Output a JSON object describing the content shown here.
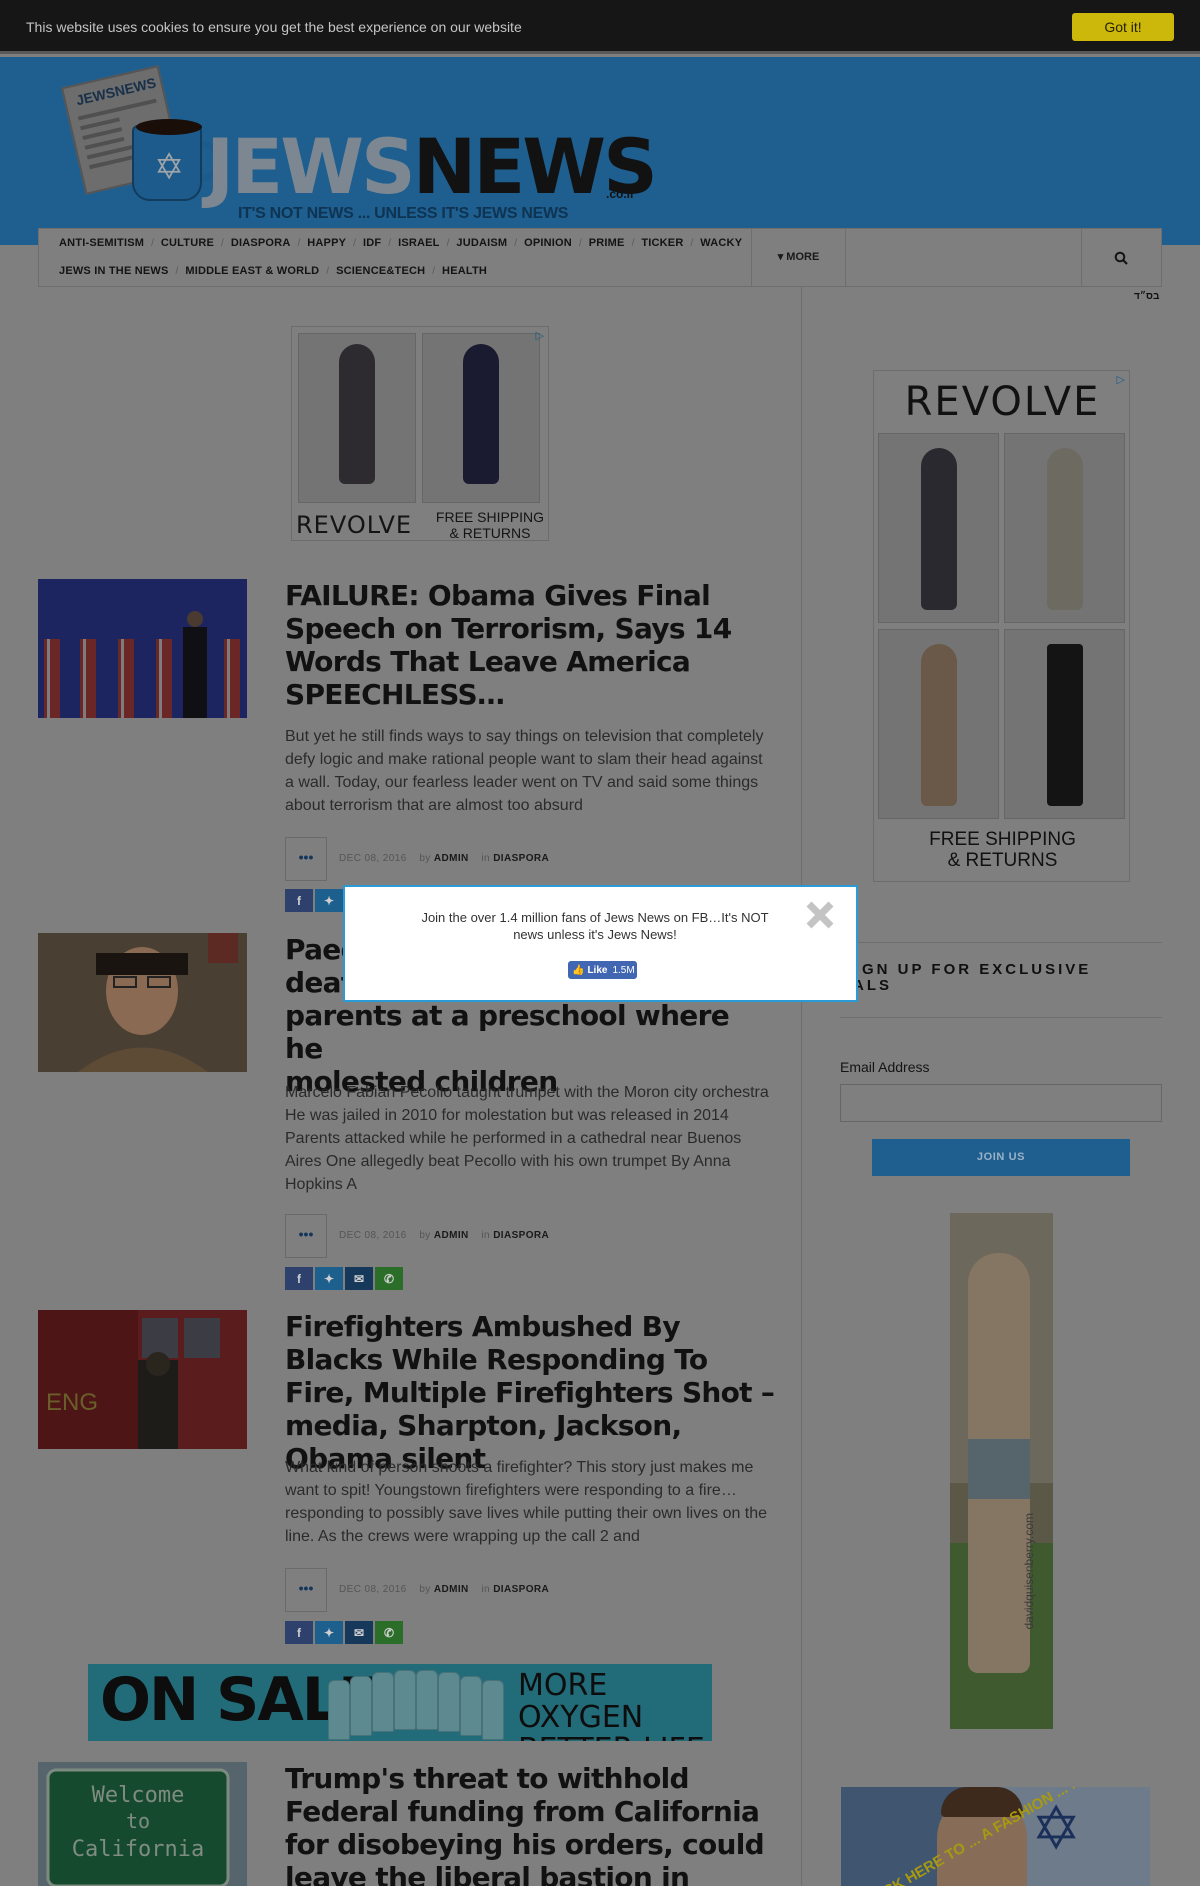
{
  "cookie": {
    "message": "This website uses cookies to ensure you get the best experience on our website",
    "button": "Got it!"
  },
  "header": {
    "logo_paper": "JEWSNEWS",
    "logo_word_1": "JEWS",
    "logo_word_2": "NEWS",
    "logo_tld": ".co.il",
    "tagline": "IT'S NOT NEWS ... UNLESS IT'S JEWS NEWS"
  },
  "nav": {
    "row1": [
      "ANTI-SEMITISM",
      "CULTURE",
      "DIASPORA",
      "HAPPY",
      "IDF",
      "ISRAEL",
      "JUDAISM",
      "OPINION",
      "PRIME",
      "TICKER",
      "WACKY"
    ],
    "row2": [
      "JEWS IN THE NEWS",
      "MIDDLE EAST & WORLD",
      "SCIENCE&TECH",
      "HEALTH"
    ],
    "more": "▾ MORE",
    "bsd": "בס״ד"
  },
  "ads": {
    "top": {
      "brand": "REVOLVE",
      "shipping": "FREE SHIPPING & RETURNS"
    },
    "side": {
      "brand": "REVOLVE",
      "shipping_1": "FREE SHIPPING",
      "shipping_2": "& RETURNS"
    },
    "adchoices_icon": "adchoices-icon",
    "sale": {
      "on_sale": "ON SALE",
      "line1": "MORE OXYGEN",
      "line2": "BETTER LIFE"
    },
    "tall": {
      "credit": "davidquisenberry.com"
    },
    "bottom": {
      "cta": "CLICK HERE TO ... A FASHION ... MENT"
    }
  },
  "articles": [
    {
      "title": "FAILURE: Obama Gives Final Speech on Terrorism, Says 14 Words That Leave America SPEECHLESS…",
      "excerpt": "But yet he still finds ways to say things on television that completely defy logic and make rational people want to slam their head against a wall. Today, our fearless leader went on TV and said some things about terrorism that are almost too absurd",
      "date": "DEC 08, 2016",
      "by": "by",
      "author": "ADMIN",
      "in": "in",
      "category": "DIASPORA"
    },
    {
      "title": "Paedophile trumpet teacher beaten to death by parents at a preschool where he molested children",
      "title_visible": "Paed… deat… parents at a preschool where he molested children",
      "excerpt": "Marcelo Fabian Pecollo taught trumpet with the Moron city orchestra He was jailed in 2010 for molestation but was released in 2014 Parents attacked while he performed in a cathedral near Buenos Aires One allegedly beat Pecollo with his own trumpet By Anna Hopkins A",
      "date": "DEC 08, 2016",
      "by": "by",
      "author": "ADMIN",
      "in": "in",
      "category": "DIASPORA"
    },
    {
      "title": "Firefighters Ambushed By Blacks While Responding To Fire, Multiple Firefighters Shot – media, Sharpton, Jackson, Obama silent",
      "excerpt": "What kind of person shoots a firefighter? This story just makes me want to spit! Youngstown firefighters were responding to a fire… responding to possibly save lives while putting their own lives on the line. As the crews were wrapping up the call 2 and",
      "date": "DEC 08, 2016",
      "by": "by",
      "author": "ADMIN",
      "in": "in",
      "category": "DIASPORA"
    },
    {
      "title": "Trump's threat to withhold Federal funding from California for disobeying his orders, could leave the liberal bastion in bankruptcy",
      "thumb_text": [
        "Welcome",
        "to",
        "California"
      ]
    }
  ],
  "article2_visible": {
    "line1": "Paed",
    "line2": "deat",
    "line3": "parents at a preschool where he",
    "line4": "molested children"
  },
  "signup": {
    "title_visible": "GN UP FOR EXCLUSIVE",
    "title_visible_2": "EALS",
    "email_label": "Email Address",
    "button": "JOIN US"
  },
  "modal": {
    "text": "Join the over 1.4 million fans of Jews News on FB…It's NOT news unless it's Jews News!",
    "like_label": "Like",
    "like_count": "1.5M"
  },
  "share_icons": [
    "facebook-icon",
    "twitter-icon",
    "email-icon",
    "whatsapp-icon"
  ],
  "meta_button": "•••",
  "colors": {
    "cookie_button": "#ccb80b",
    "header_blue": "#1e5f8f",
    "modal_border": "#2a9bd6",
    "facebook": "#4267b2"
  }
}
